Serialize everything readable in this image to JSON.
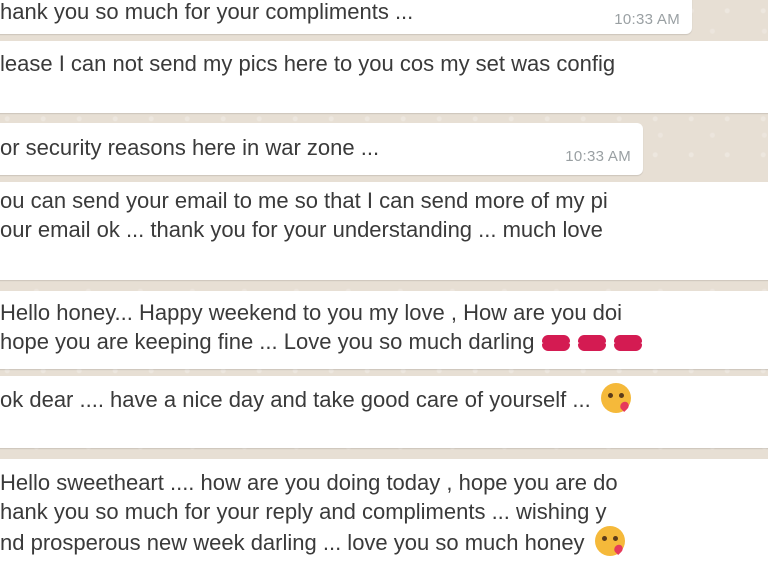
{
  "messages": [
    {
      "lines": [
        "hank you so much for your compliments ..."
      ],
      "time": "10:33 AM"
    },
    {
      "lines": [
        "lease I can not send my pics here to you cos my set was config"
      ],
      "time": ""
    },
    {
      "lines": [
        "or security reasons here in war zone ..."
      ],
      "time": "10:33 AM"
    },
    {
      "lines": [
        "ou can send your email to me so that I can send more of my pi",
        "our email ok ... thank you for your understanding ... much love"
      ],
      "time": ""
    },
    {
      "lines": [
        "Hello honey... Happy weekend to you my love , How are you doi",
        "hope you are keeping fine ... Love you so much darling"
      ],
      "time": ""
    },
    {
      "lines": [
        "ok dear .... have a nice day and take good care of yourself ..."
      ],
      "time": ""
    },
    {
      "lines": [
        "Hello sweetheart .... how are you doing today , hope you are do",
        "hank you so much for your reply and compliments ... wishing y",
        "nd prosperous new week darling ... love you so much honey"
      ],
      "time": ""
    }
  ],
  "emojis": {
    "kiss": "kiss-mark-icon",
    "face": "face-blowing-kiss-icon"
  }
}
